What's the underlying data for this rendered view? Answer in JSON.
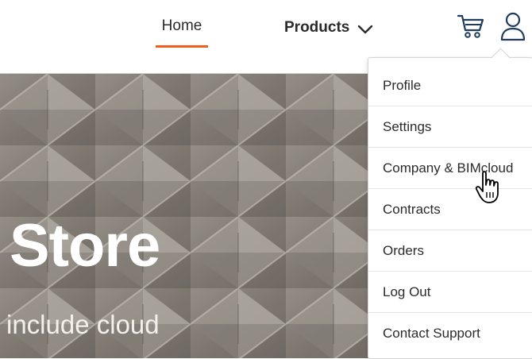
{
  "nav": {
    "home_label": "Home",
    "products_label": "Products"
  },
  "hero": {
    "title": "Store",
    "subtitle": "include cloud"
  },
  "user_menu": {
    "items": [
      {
        "label": "Profile"
      },
      {
        "label": "Settings"
      },
      {
        "label": "Company & BIMcloud"
      },
      {
        "label": "Contracts"
      },
      {
        "label": "Orders"
      },
      {
        "label": "Log Out"
      },
      {
        "label": "Contact Support"
      }
    ]
  },
  "colors": {
    "accent": "#f25c1d",
    "text": "#2b2b2b",
    "icon": "#1f3c5a"
  },
  "icons": [
    "chevron-down-icon",
    "cart-icon",
    "user-icon",
    "hand-pointer-icon"
  ]
}
